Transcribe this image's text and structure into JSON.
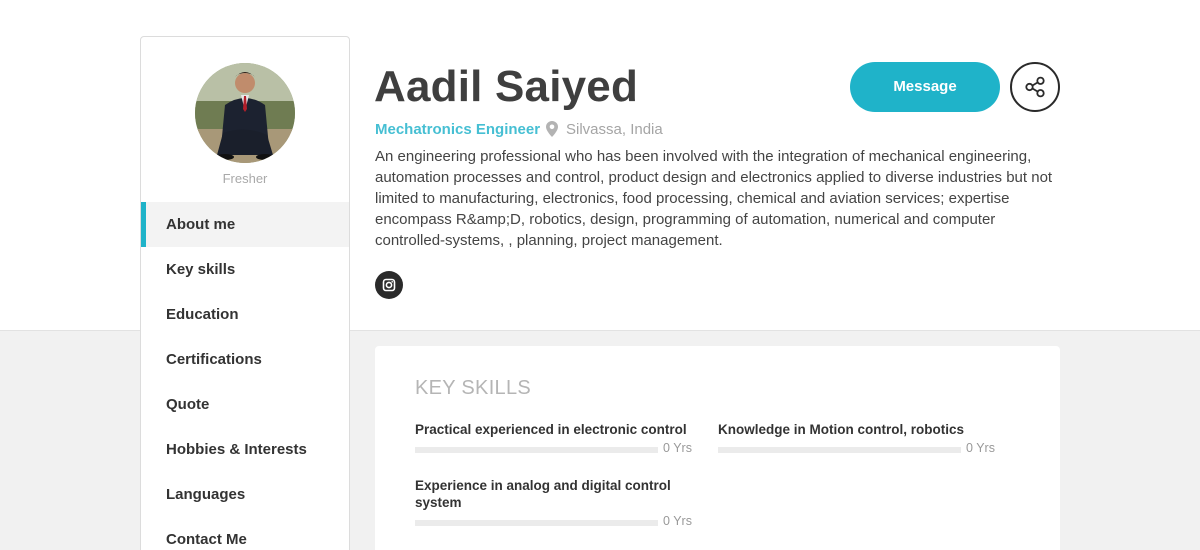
{
  "profile": {
    "name": "Aadil Saiyed",
    "role": "Mechatronics Engineer",
    "location": "Silvassa, India",
    "status": "Fresher",
    "bio": "An engineering professional who has been involved with the integration of mechanical engineering, automation processes and control, product design and electronics applied to diverse industries but not limited to manufacturing, electronics, food processing, chemical and aviation services; expertise encompass R&amp;D, robotics, design, programming of automation, numerical and computer controlled-systems, , planning, project management."
  },
  "actions": {
    "message_label": "Message",
    "share_icon": "share-icon",
    "social_icon": "instagram-icon"
  },
  "sidebar": {
    "items": [
      {
        "label": "About me",
        "active": true
      },
      {
        "label": "Key skills",
        "active": false
      },
      {
        "label": "Education",
        "active": false
      },
      {
        "label": "Certifications",
        "active": false
      },
      {
        "label": "Quote",
        "active": false
      },
      {
        "label": "Hobbies & Interests",
        "active": false
      },
      {
        "label": "Languages",
        "active": false
      },
      {
        "label": "Contact Me",
        "active": false
      }
    ]
  },
  "skills": {
    "title": "KEY SKILLS",
    "items": [
      {
        "name": "Practical experienced in electronic control",
        "years": "0 Yrs",
        "level": 0
      },
      {
        "name": "Knowledge in Motion control, robotics",
        "years": "0 Yrs",
        "level": 0
      },
      {
        "name": "Experience in analog and digital control system",
        "years": "0 Yrs",
        "level": 0
      }
    ]
  },
  "colors": {
    "accent": "#1fb3c9",
    "role_text": "#46bfd3",
    "dark": "#2a2a2a"
  }
}
